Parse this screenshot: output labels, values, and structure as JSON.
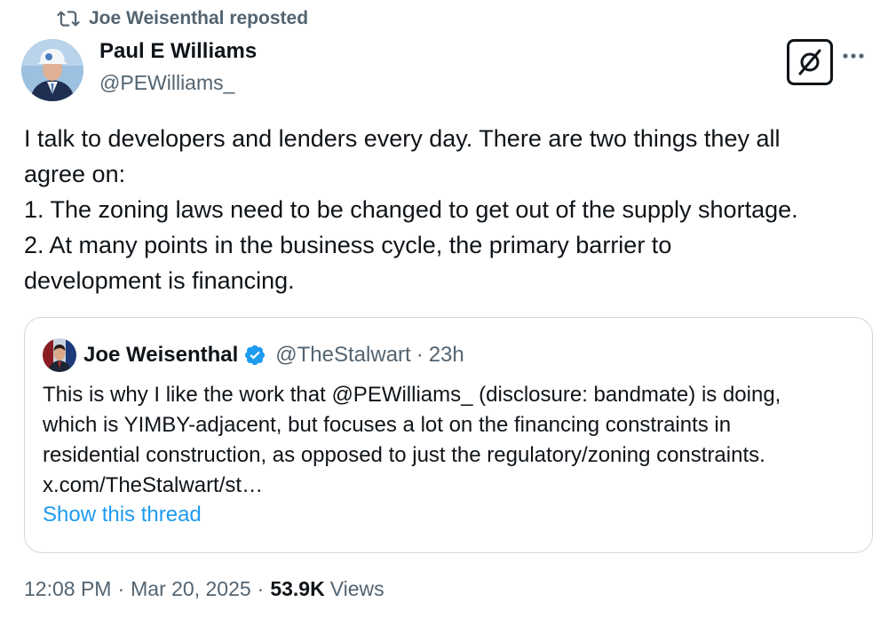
{
  "repost": {
    "label": "Joe Weisenthal reposted"
  },
  "author": {
    "name": "Paul E Williams",
    "handle": "@PEWilliams_"
  },
  "tweet": {
    "lines": [
      "I talk to developers and lenders every day. There are two things they all",
      "agree on:",
      "1. The zoning laws need to be changed to get out of the supply shortage.",
      "2. At many points in the business cycle, the primary barrier to",
      "development is financing."
    ]
  },
  "quote": {
    "name": "Joe Weisenthal",
    "handle": "@TheStalwart",
    "separator": "·",
    "time": "23h",
    "lines": [
      "This is why I like the work that @PEWilliams_ (disclosure: bandmate) is doing,",
      "which is YIMBY-adjacent, but focuses a lot on the financing constraints in",
      "residential construction, as opposed to just the regulatory/zoning constraints.",
      "x.com/TheStalwart/st…"
    ],
    "show_thread": "Show this thread",
    "verified_color": "#1d9bf0"
  },
  "footer": {
    "time": "12:08 PM",
    "sep1": "·",
    "date": "Mar 20, 2025",
    "sep2": "·",
    "views_count": "53.9K",
    "views_label": "Views"
  },
  "icons": {
    "repost": "repost-icon",
    "grok": "grok-icon",
    "more": "more-icon",
    "verified": "verified-badge-icon"
  }
}
